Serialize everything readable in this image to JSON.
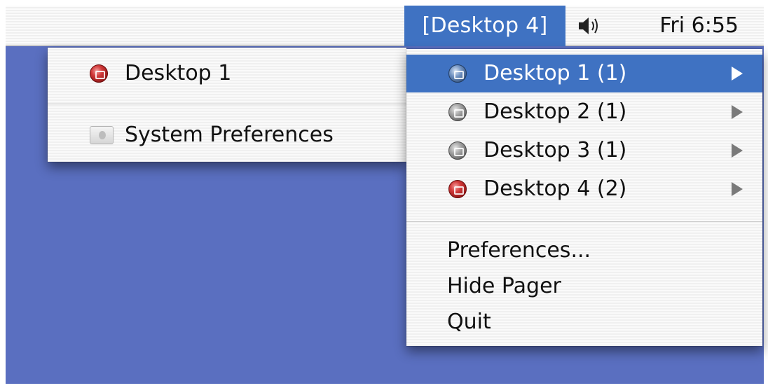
{
  "menubar": {
    "current_desktop": "[Desktop 4]",
    "clock": "Fri 6:55",
    "volume_icon": "speaker-icon"
  },
  "left_menu": {
    "items": [
      {
        "label": "Desktop 1",
        "icon": "red-desktop-icon"
      },
      {
        "label": "System Preferences",
        "icon": "system-preferences-icon"
      }
    ]
  },
  "right_menu": {
    "desktops": [
      {
        "label": "Desktop 1 (1)",
        "icon": "blue-desktop-icon",
        "highlighted": true
      },
      {
        "label": "Desktop 2 (1)",
        "icon": "gray-desktop-icon",
        "highlighted": false
      },
      {
        "label": "Desktop 3 (1)",
        "icon": "gray-desktop-icon",
        "highlighted": false
      },
      {
        "label": "Desktop 4 (2)",
        "icon": "red-desktop-icon",
        "highlighted": false
      }
    ],
    "actions": [
      {
        "label": "Preferences..."
      },
      {
        "label": "Hide Pager"
      },
      {
        "label": "Quit"
      }
    ]
  },
  "colors": {
    "desktop_background": "#5a6fc0",
    "highlight": "#3f72c2"
  }
}
